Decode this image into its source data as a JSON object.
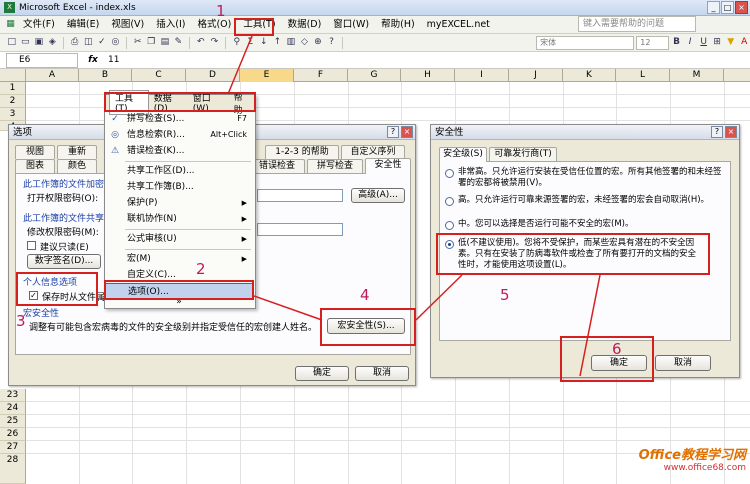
{
  "window": {
    "title": "Microsoft Excel - index.xls"
  },
  "menubar": {
    "items": [
      "文件(F)",
      "编辑(E)",
      "视图(V)",
      "插入(I)",
      "格式(O)",
      "工具(T)",
      "数据(D)",
      "窗口(W)",
      "帮助(H)",
      "myEXCEL.net"
    ],
    "help_placeholder": "键入需要帮助的问题"
  },
  "toolbar": {
    "font_name": "宋体",
    "font_size": "12"
  },
  "formula": {
    "cell": "E6",
    "fx": "fx",
    "value": "11"
  },
  "sheet": {
    "columns": [
      "A",
      "B",
      "C",
      "D",
      "E",
      "F",
      "G",
      "H",
      "I",
      "J",
      "K",
      "L",
      "M"
    ],
    "visible_rows": [
      "1",
      "2",
      "3",
      "4",
      "23",
      "24",
      "25",
      "26",
      "27",
      "28"
    ]
  },
  "tools_menu": {
    "header": [
      "工具(T)",
      "数据(D)",
      "窗口(W)",
      "帮助"
    ],
    "items": [
      "拼写检查(S)...",
      "信息检索(R)...",
      "错误检查(K)...",
      "共享工作区(D)...",
      "共享工作簿(B)...",
      "保护(P)",
      "联机协作(N)",
      "公式审核(U)",
      "宏(M)",
      "自定义(C)...",
      "选项(O)...",
      "»"
    ],
    "shortcuts": {
      "spell": "F7",
      "research": "Alt+Click"
    }
  },
  "options_dialog": {
    "title": "选项",
    "tabs_row1": [
      "视图",
      "重新",
      "1-2-3 的帮助",
      "自定义序列"
    ],
    "tabs_row2": [
      "图表",
      "颜色",
      "错误检查",
      "拼写检查",
      "安全性"
    ],
    "section1": "此工作簿的文件加密设",
    "open_password": "打开权限密码(O):",
    "advanced": "高级(A)...",
    "section2": "此工作簿的文件共享设",
    "modify_password": "修改权限密码(M):",
    "readonly": "建议只读(E)",
    "digital_sig": "数字签名(D)...",
    "privacy_section": "个人信息选项",
    "privacy_check": "保存时从文件属",
    "macro_section": "宏安全性",
    "macro_desc": "调整有可能包含宏病毒的文件的安全级别并指定受信任的宏创建人姓名。",
    "macro_button": "宏安全性(S)...",
    "ok": "确定",
    "cancel": "取消"
  },
  "security_dialog": {
    "title": "安全性",
    "tabs": [
      "安全级(S)",
      "可靠发行商(T)"
    ],
    "options": [
      "非常高。只允许运行安装在受信任位置的宏。所有其他签署的和未经签署的宏都将被禁用(V)。",
      "高。只允许运行可靠来源签署的宏，未经签署的宏会自动取消(H)。",
      "中。您可以选择是否运行可能不安全的宏(M)。",
      "低(不建议使用)。您将不受保护，而某些宏具有潜在的不安全因素。只有在安装了防病毒软件或检查了所有要打开的文档的安全性时，才能使用这项设置(L)。"
    ],
    "selected": 3,
    "ok": "确定",
    "cancel": "取消"
  },
  "annotations": [
    "1",
    "2",
    "3",
    "4",
    "5",
    "6"
  ],
  "watermark": {
    "line1": "Office教程学习网",
    "line2": "www.office68.com"
  }
}
